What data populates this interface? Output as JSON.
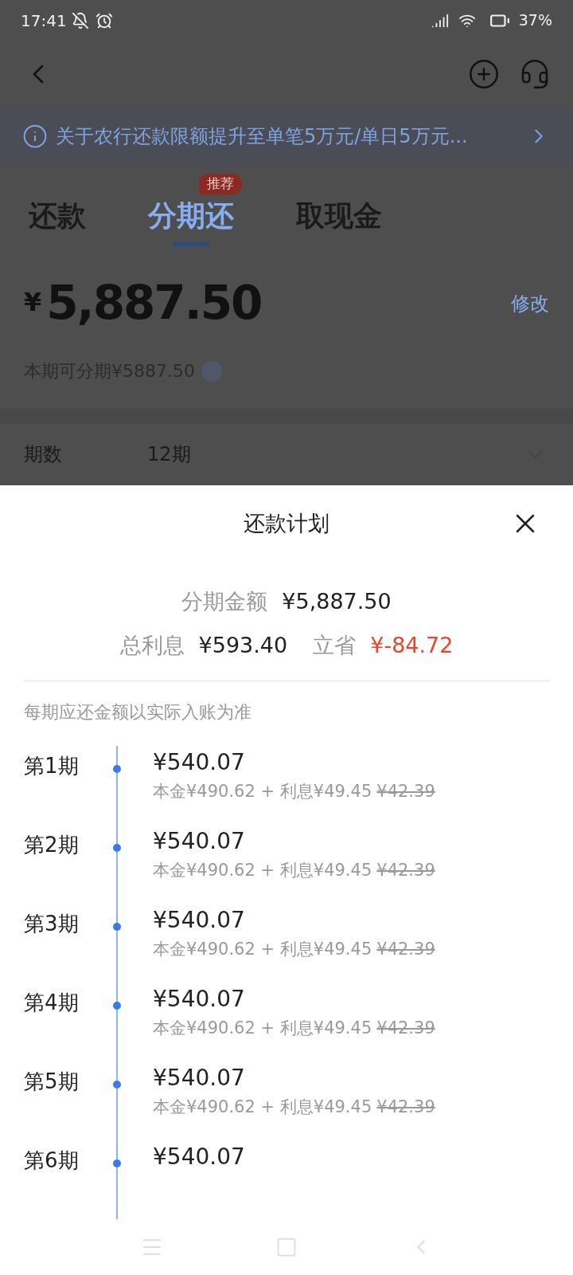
{
  "status_bar": {
    "time": "17:41",
    "battery": "37%"
  },
  "notice": {
    "text": "关于农行还款限额提升至单笔5万元/单日5万元..."
  },
  "tabs": [
    {
      "label": "还款",
      "selected": false
    },
    {
      "label": "分期还",
      "selected": true,
      "badge": "推荐"
    },
    {
      "label": "取现金",
      "selected": false
    }
  ],
  "amount": {
    "currency": "¥",
    "value": "5,887.50",
    "edit": "修改",
    "available": "本期可分期¥5887.50"
  },
  "term": {
    "label": "期数",
    "value": "12期"
  },
  "sheet": {
    "title": "还款计划",
    "summary": [
      {
        "label": "分期金额",
        "value": "¥5,887.50"
      }
    ],
    "summary2": [
      {
        "label": "总利息",
        "value": "¥593.40",
        "highlight": false
      },
      {
        "label": "立省",
        "value": "¥-84.72",
        "highlight": true
      }
    ],
    "note": "每期应还金额以实际入账为准",
    "periods": [
      {
        "label": "第1期",
        "amount": "¥540.07",
        "detail": "本金¥490.62 + 利息¥49.45",
        "old_interest": "¥42.39"
      },
      {
        "label": "第2期",
        "amount": "¥540.07",
        "detail": "本金¥490.62 + 利息¥49.45",
        "old_interest": "¥42.39"
      },
      {
        "label": "第3期",
        "amount": "¥540.07",
        "detail": "本金¥490.62 + 利息¥49.45",
        "old_interest": "¥42.39"
      },
      {
        "label": "第4期",
        "amount": "¥540.07",
        "detail": "本金¥490.62 + 利息¥49.45",
        "old_interest": "¥42.39"
      },
      {
        "label": "第5期",
        "amount": "¥540.07",
        "detail": "本金¥490.62 + 利息¥49.45",
        "old_interest": "¥42.39"
      },
      {
        "label": "第6期",
        "amount": "¥540.07"
      }
    ]
  }
}
